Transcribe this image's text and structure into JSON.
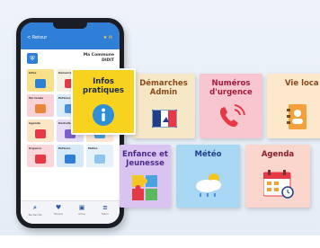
{
  "phone": {
    "back_label": "< Retour",
    "header_icons": "★ ✉",
    "title": "Ma Commune\nDIDIT",
    "mini_tiles": [
      {
        "label": "Infos",
        "color": "#f7e08a",
        "icon_color": "#2f7fd6"
      },
      {
        "label": "Démarches",
        "color": "#f5efe2",
        "icon_color": "#e53946"
      },
      {
        "label": "Urgence",
        "color": "#f9d3d8",
        "icon_color": "#e53946"
      },
      {
        "label": "Vie locale",
        "color": "#f7d2d6",
        "icon_color": "#e8863b"
      },
      {
        "label": "Enfance",
        "color": "#d9ecfb",
        "icon_color": "#4a8fe0"
      },
      {
        "label": "Météo",
        "color": "#d9f0d9",
        "icon_color": "#6cb96c"
      },
      {
        "label": "Agenda",
        "color": "#fbe7c8",
        "icon_color": "#e53946"
      },
      {
        "label": "Déchets",
        "color": "#e7ddf7",
        "icon_color": "#7b61c9"
      },
      {
        "label": "Transport",
        "color": "#fde7d8",
        "icon_color": "#4aa3e0"
      },
      {
        "label": "Urgence",
        "color": "#fbd7da",
        "icon_color": "#e53946"
      },
      {
        "label": "Enfance",
        "color": "#d6e9fb",
        "icon_color": "#2f7fd6"
      },
      {
        "label": "Météo",
        "color": "#e5f2fb",
        "icon_color": "#8fc4ee"
      }
    ],
    "nav": [
      {
        "icon": "⌕",
        "label": "Recherche"
      },
      {
        "icon": "♥",
        "label": "Favoris"
      },
      {
        "icon": "▣",
        "label": "Actus"
      },
      {
        "icon": "≡",
        "label": "Menu"
      }
    ]
  },
  "tiles": {
    "infos": {
      "label": "Infos pratiques",
      "bg": "#f7d31f"
    },
    "demarches": {
      "label": "Démarches Admin",
      "bg": "#f6e7c6"
    },
    "urgence": {
      "label": "Numéros d'urgence",
      "bg": "#f8c6cf"
    },
    "vie": {
      "label": "Vie loca",
      "bg": "#fde8cc"
    },
    "enfance": {
      "label": "Enfance et Jeunesse",
      "bg": "#d9c3f1"
    },
    "meteo": {
      "label": "Météo",
      "bg": "#a8d7f4"
    },
    "agenda": {
      "label": "Agenda",
      "bg": "#fbd6cc"
    }
  }
}
